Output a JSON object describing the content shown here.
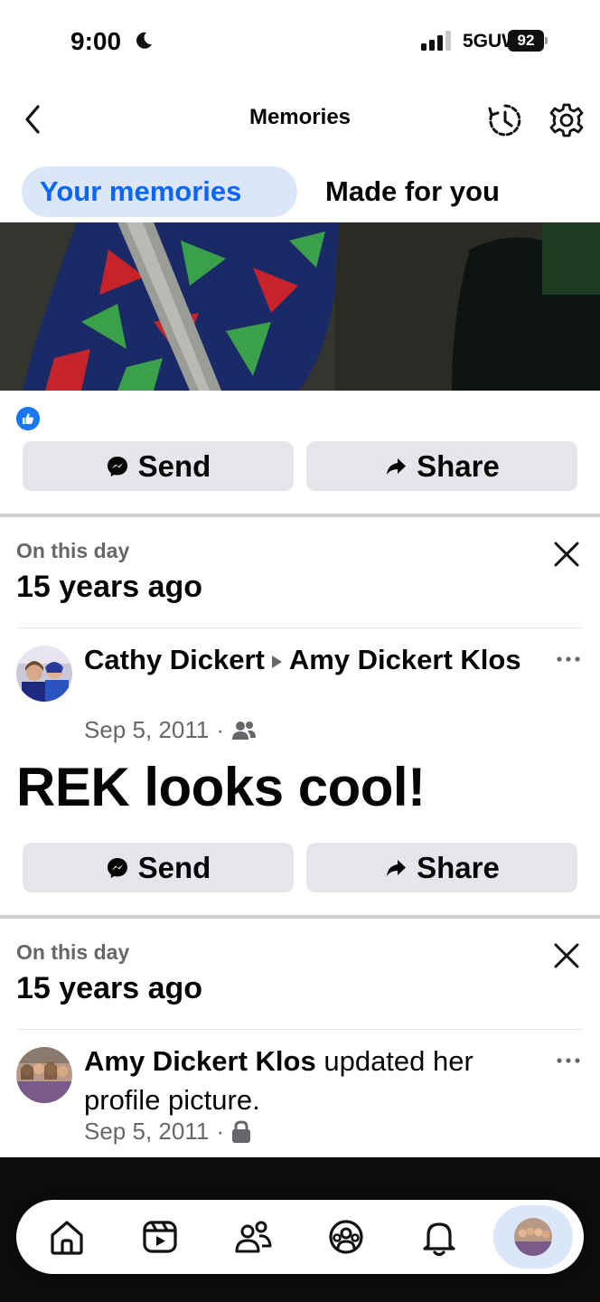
{
  "status_bar": {
    "time": "9:00",
    "network": "5GUW",
    "battery": "92"
  },
  "header": {
    "title": "Memories"
  },
  "tabs": [
    {
      "label": "Your memories",
      "active": true
    },
    {
      "label": "Made for you",
      "active": false
    }
  ],
  "first_post": {
    "send_label": "Send",
    "share_label": "Share"
  },
  "memory_1": {
    "on_this_day": "On this day",
    "years_ago": "15 years ago",
    "author": "Cathy Dickert",
    "recipient": "Amy Dickert Klos",
    "date": "Sep 5, 2011",
    "audience_icon": "friends-icon",
    "text": "REK looks cool!",
    "send_label": "Send",
    "share_label": "Share"
  },
  "memory_2": {
    "on_this_day": "On this day",
    "years_ago": "15 years ago",
    "author": "Amy Dickert Klos",
    "action": "updated her profile picture.",
    "date": "Sep 5, 2011",
    "audience_icon": "lock-icon"
  },
  "bottom_nav": [
    {
      "name": "home",
      "icon": "home-icon"
    },
    {
      "name": "video",
      "icon": "video-icon"
    },
    {
      "name": "friends",
      "icon": "friends-icon"
    },
    {
      "name": "groups",
      "icon": "groups-icon"
    },
    {
      "name": "notifications",
      "icon": "bell-icon"
    },
    {
      "name": "profile",
      "icon": "profile-avatar"
    }
  ],
  "colors": {
    "accent": "#0866ff",
    "tab_active_bg": "#dbe7f8",
    "button_bg": "#e4e6eb",
    "secondary_text": "#65676b"
  }
}
